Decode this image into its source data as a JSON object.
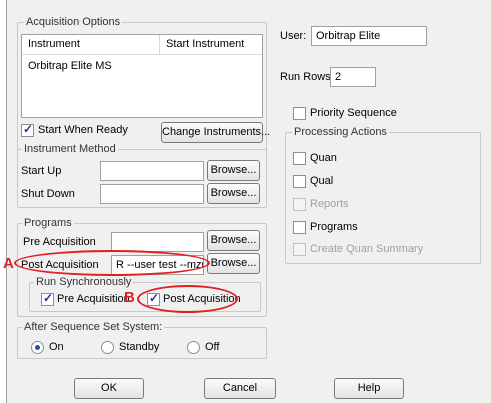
{
  "acquisition_options": {
    "title": "Acquisition Options",
    "columns": [
      "Instrument",
      "Start Instrument"
    ],
    "rows": [
      [
        "Orbitrap Elite MS",
        ""
      ]
    ],
    "start_when_ready_label": "Start When Ready",
    "start_when_ready_checked": true,
    "change_instruments_label": "Change Instruments..."
  },
  "instrument_method": {
    "title": "Instrument Method",
    "start_up_label": "Start Up",
    "start_up_value": "",
    "shut_down_label": "Shut Down",
    "shut_down_value": "",
    "browse_label": "Browse..."
  },
  "programs": {
    "title": "Programs",
    "pre_acquisition_label": "Pre Acquisition",
    "pre_acquisition_value": "",
    "post_acquisition_label": "Post Acquisition",
    "post_acquisition_value": "R --user test --mzml",
    "browse_label": "Browse...",
    "run_sync_title": "Run Synchronously",
    "sync_pre_label": "Pre Acquisition",
    "sync_pre_checked": true,
    "sync_post_label": "Post Acquisition",
    "sync_post_checked": true
  },
  "after_sequence": {
    "title": "After Sequence Set System:",
    "options": [
      "On",
      "Standby",
      "Off"
    ],
    "selected": "On"
  },
  "user": {
    "label": "User:",
    "value": "Orbitrap Elite"
  },
  "run_rows": {
    "label": "Run Rows:",
    "value": "2"
  },
  "priority_sequence": {
    "label": "Priority Sequence",
    "checked": false
  },
  "processing_actions": {
    "title": "Processing Actions",
    "items": [
      {
        "label": "Quan",
        "checked": false,
        "enabled": true
      },
      {
        "label": "Qual",
        "checked": false,
        "enabled": true
      },
      {
        "label": "Reports",
        "checked": false,
        "enabled": false
      },
      {
        "label": "Programs",
        "checked": false,
        "enabled": true
      },
      {
        "label": "Create Quan Summary",
        "checked": false,
        "enabled": false
      }
    ]
  },
  "footer": {
    "ok_label": "OK",
    "cancel_label": "Cancel",
    "help_label": "Help"
  },
  "annotations": {
    "a_label": "A",
    "b_label": "B",
    "accent_color": "#e02020"
  }
}
